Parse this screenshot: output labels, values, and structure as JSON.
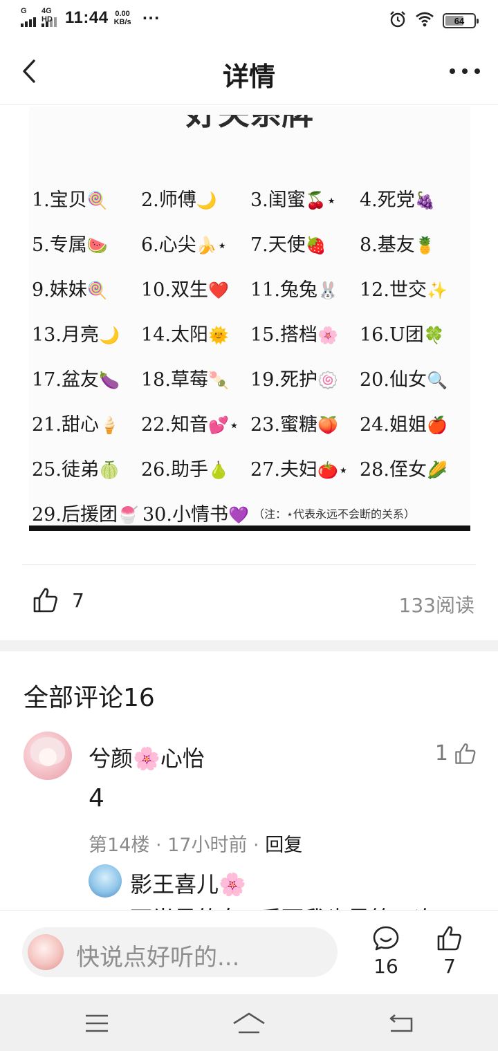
{
  "status": {
    "net1": "G",
    "net2": "4G HD",
    "time": "11:44",
    "speed_value": "0.00",
    "speed_unit": "KB/s",
    "dots": "···",
    "battery": "64",
    "battery_level": 0.64
  },
  "header": {
    "title": "详情"
  },
  "post": {
    "image_heading": "好关系牌",
    "rows": [
      [
        {
          "label": "1.宝贝",
          "emoji": "🍭"
        },
        {
          "label": "2.师傅",
          "emoji": "🌙"
        },
        {
          "label": "3.闺蜜",
          "emoji": "🍒⋆"
        },
        {
          "label": "4.死党",
          "emoji": "🍇"
        }
      ],
      [
        {
          "label": "5.专属",
          "emoji": "🍉"
        },
        {
          "label": "6.心尖",
          "emoji": "🍌⋆"
        },
        {
          "label": "7.天使",
          "emoji": "🍓"
        },
        {
          "label": "8.基友",
          "emoji": "🍍"
        }
      ],
      [
        {
          "label": "9.妹妹",
          "emoji": "🍭"
        },
        {
          "label": "10.双生",
          "emoji": "❤️"
        },
        {
          "label": "11.兔兔",
          "emoji": "🐰"
        },
        {
          "label": "12.世交",
          "emoji": "✨"
        }
      ],
      [
        {
          "label": "13.月亮",
          "emoji": "🌙"
        },
        {
          "label": "14.太阳",
          "emoji": "🌞"
        },
        {
          "label": "15.搭档",
          "emoji": "🌸"
        },
        {
          "label": "16.U团",
          "emoji": "🍀"
        }
      ],
      [
        {
          "label": "17.盆友",
          "emoji": "🍆"
        },
        {
          "label": "18.草莓",
          "emoji": "🍡"
        },
        {
          "label": "19.死护",
          "emoji": "🍥"
        },
        {
          "label": "20.仙女",
          "emoji": "🔍"
        }
      ],
      [
        {
          "label": "21.甜心",
          "emoji": "🍦"
        },
        {
          "label": "22.知音",
          "emoji": "💕⋆"
        },
        {
          "label": "23.蜜糖",
          "emoji": "🍑"
        },
        {
          "label": "24.姐姐",
          "emoji": "🍎"
        }
      ],
      [
        {
          "label": "25.徒弟",
          "emoji": "🍈"
        },
        {
          "label": "26.助手",
          "emoji": "🍐"
        },
        {
          "label": "27.夫妇",
          "emoji": "🍅⋆"
        },
        {
          "label": "28.侄女",
          "emoji": "🌽"
        }
      ],
      [
        {
          "label": "29.后援团",
          "emoji": "🍧"
        },
        {
          "label": "30.小情书",
          "emoji": "💜"
        }
      ]
    ],
    "image_note": "（注：⋆代表永远不会断的关系）",
    "like_count": "7",
    "read_count": "133阅读"
  },
  "comments": {
    "title": "全部评论16",
    "items": [
      {
        "name": "兮颜🌸心怡",
        "like_count": "1",
        "text": "4",
        "floor": "第14楼",
        "sep": " · ",
        "time": "17小时前",
        "reply_label": "回复",
        "reply": {
          "name": "影王喜儿🌸",
          "text": "下半是的女⊙后面我也是第一次"
        }
      }
    ]
  },
  "input": {
    "placeholder": "快说点好听的..."
  },
  "bottom_bar": {
    "comment_count": "16",
    "like_count": "7"
  },
  "colors": {
    "text": "#1a1a1a",
    "muted": "#8a8a8a",
    "divider": "#ececec",
    "section_gap": "#f2f2f2",
    "nav_bg": "#f0f0f0"
  }
}
